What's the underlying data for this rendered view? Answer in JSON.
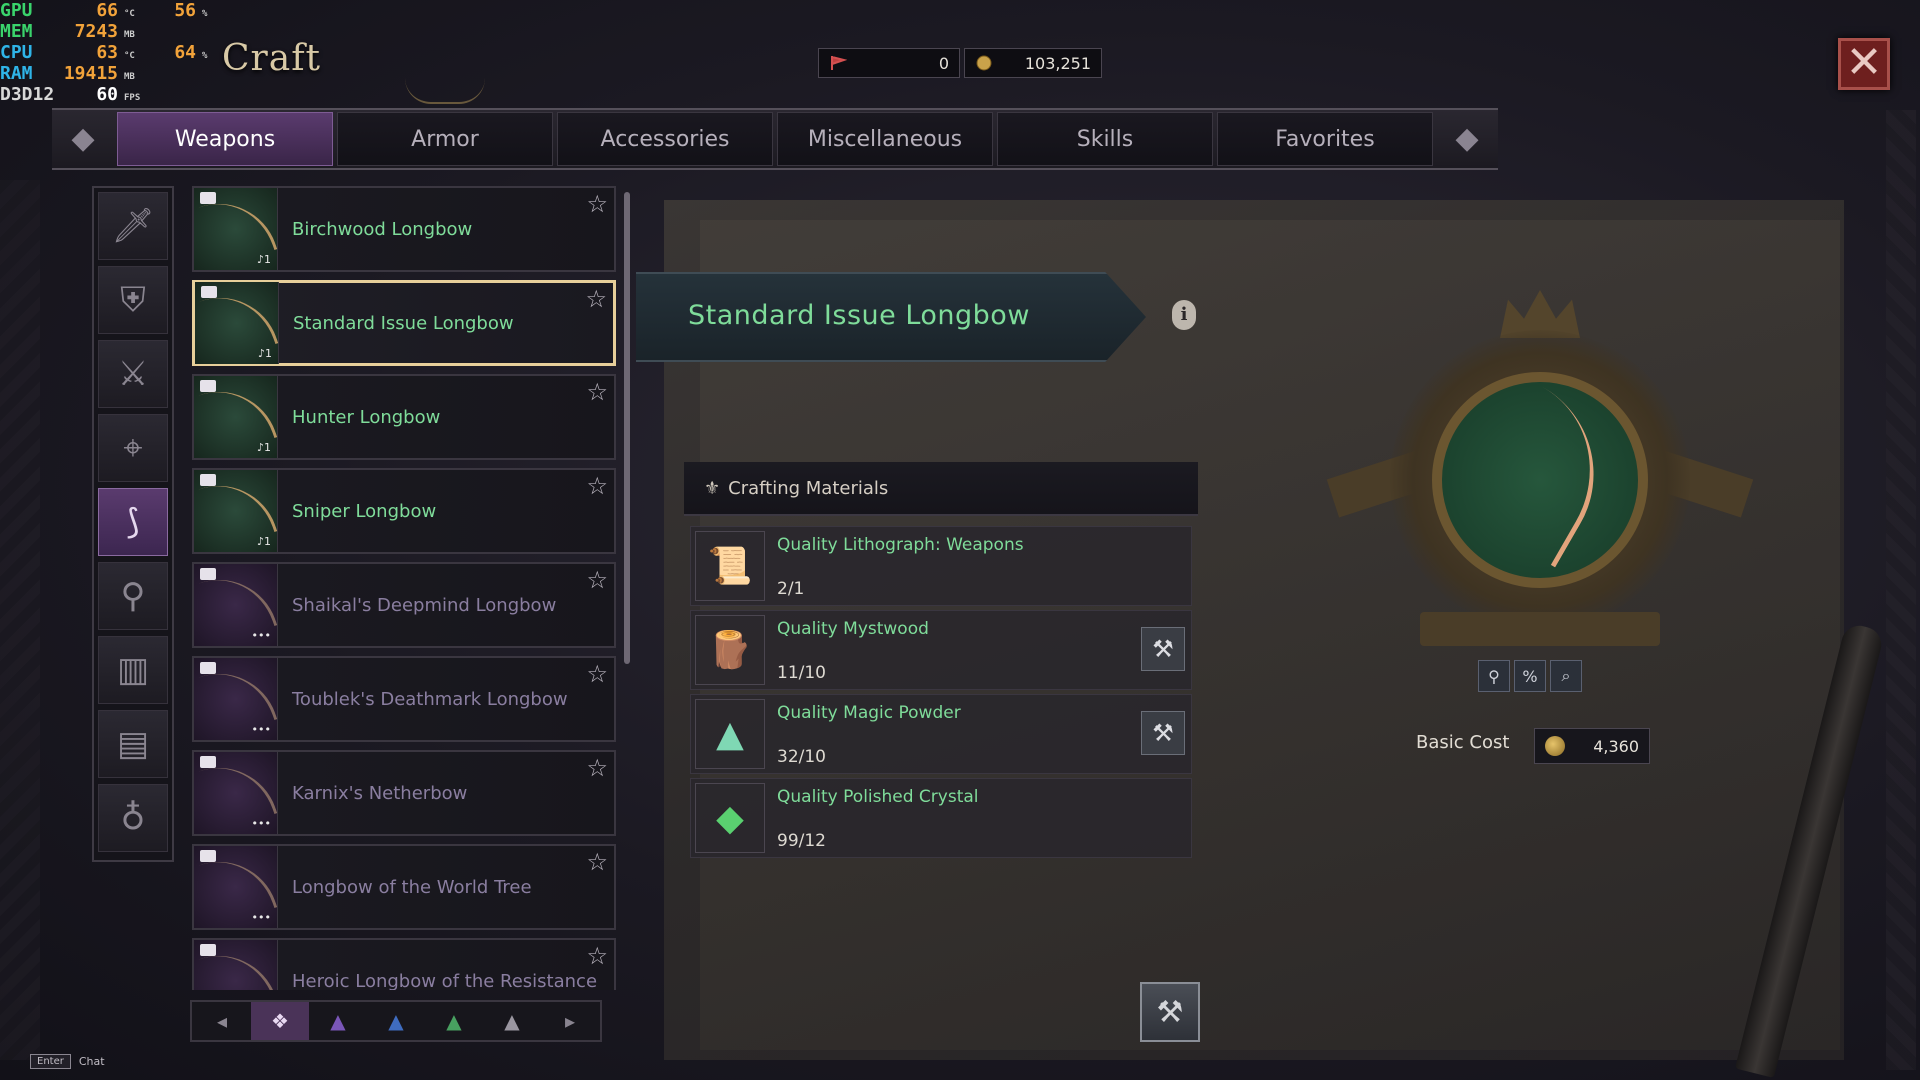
{
  "perf": [
    {
      "key": "GPU",
      "val": "66",
      "unit": "°C",
      "val2": "56",
      "unit2": "%"
    },
    {
      "key": "MEM",
      "val": "7243",
      "unit": "MB",
      "val2": "",
      "unit2": ""
    },
    {
      "key": "CPU",
      "val": "63",
      "unit": "°C",
      "val2": "64",
      "unit2": "%"
    },
    {
      "key": "RAM",
      "val": "19415",
      "unit": "MB",
      "val2": "",
      "unit2": ""
    },
    {
      "key": "D3D12",
      "val": "60",
      "unit": "FPS",
      "val2": "",
      "unit2": ""
    }
  ],
  "window": {
    "title": "Craft"
  },
  "currency": {
    "tokens": "0",
    "gold": "103,251"
  },
  "tabs": [
    {
      "label": "Weapons",
      "active": true
    },
    {
      "label": "Armor",
      "active": false
    },
    {
      "label": "Accessories",
      "active": false
    },
    {
      "label": "Miscellaneous",
      "active": false
    },
    {
      "label": "Skills",
      "active": false
    },
    {
      "label": "Favorites",
      "active": false
    }
  ],
  "categories": [
    {
      "icon": "dagger-icon",
      "glyph": "🗡"
    },
    {
      "icon": "shield-sword-icon",
      "glyph": "⛨"
    },
    {
      "icon": "crossed-swords-icon",
      "glyph": "⚔"
    },
    {
      "icon": "crossbow-icon",
      "glyph": "⌖"
    },
    {
      "icon": "longbow-icon",
      "glyph": "⟆",
      "active": true
    },
    {
      "icon": "staff-icon",
      "glyph": "⚲"
    },
    {
      "icon": "spellbook-icon",
      "glyph": "▥"
    },
    {
      "icon": "chest-icon",
      "glyph": "▤"
    },
    {
      "icon": "pouch-icon",
      "glyph": "♁"
    }
  ],
  "recipes": [
    {
      "name": "Birchwood Longbow",
      "available": true,
      "badge": "♪1"
    },
    {
      "name": "Standard Issue Longbow",
      "available": true,
      "badge": "♪1",
      "selected": true
    },
    {
      "name": "Hunter Longbow",
      "available": true,
      "badge": "♪1"
    },
    {
      "name": "Sniper Longbow",
      "available": true,
      "badge": "♪1"
    },
    {
      "name": "Shaikal's Deepmind Longbow",
      "available": false,
      "badge": "•••"
    },
    {
      "name": "Toublek's Deathmark Longbow",
      "available": false,
      "badge": "•••"
    },
    {
      "name": "Karnix's Netherbow",
      "available": false,
      "badge": "•••"
    },
    {
      "name": "Longbow of the World Tree",
      "available": false,
      "badge": "•••"
    },
    {
      "name": "Heroic Longbow of the Resistance",
      "available": false,
      "badge": ""
    }
  ],
  "filters": [
    "❖",
    "▲",
    "▲",
    "▲",
    "▲"
  ],
  "detail": {
    "title": "Standard Issue Longbow",
    "materials_header": "Crafting Materials",
    "materials": [
      {
        "name": "Quality Lithograph: Weapons",
        "count": "2/1",
        "icon": "scroll-icon",
        "glyph": "📜",
        "tool": false
      },
      {
        "name": "Quality Mystwood",
        "count": "11/10",
        "icon": "wood-icon",
        "glyph": "🪵",
        "tool": true
      },
      {
        "name": "Quality Magic Powder",
        "count": "32/10",
        "icon": "powder-icon",
        "glyph": "▲",
        "tool": true
      },
      {
        "name": "Quality Polished Crystal",
        "count": "99/12",
        "icon": "crystal-icon",
        "glyph": "◆",
        "tool": false
      }
    ],
    "cost_label": "Basic Cost",
    "cost_value": "4,360"
  },
  "chat": {
    "key": "Enter",
    "label": "Chat"
  },
  "colors": {
    "accent_purple": "#5a3b6e",
    "available_green": "#7fdc9a",
    "unavailable_purple": "#8a7ea0",
    "selected_border": "#e7cf9a"
  }
}
